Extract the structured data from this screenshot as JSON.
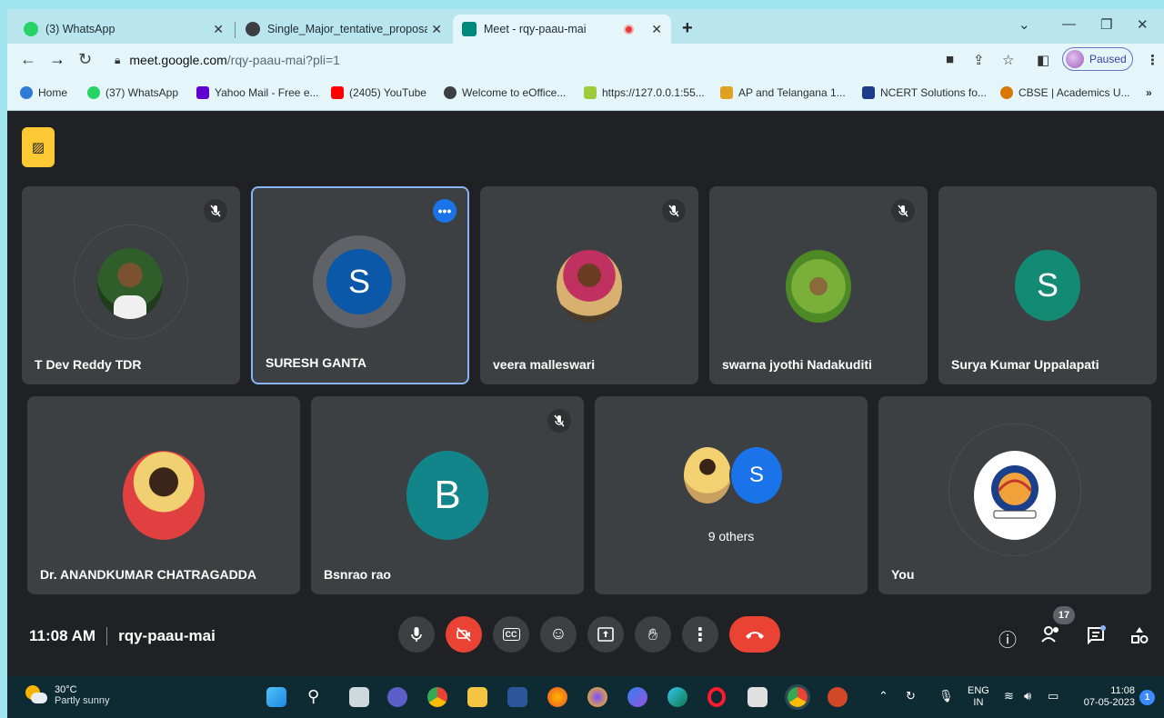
{
  "browser": {
    "tabs": [
      {
        "title": "(3) WhatsApp",
        "icon": "whatsapp-icon"
      },
      {
        "title": "Single_Major_tentative_proposal",
        "icon": "globe-icon"
      },
      {
        "title": "Meet - rqy-paau-mai",
        "icon": "meet-icon"
      }
    ],
    "url_host": "meet.google.com",
    "url_path": "/rqy-paau-mai?pli=1",
    "profile_status": "Paused",
    "bookmarks": [
      {
        "label": "Home",
        "color": "#2f7bd6"
      },
      {
        "label": "(37) WhatsApp",
        "color": "#25d366"
      },
      {
        "label": "Yahoo Mail - Free e...",
        "color": "#6001d2"
      },
      {
        "label": "(2405) YouTube",
        "color": "#ff0000"
      },
      {
        "label": "Welcome to eOffice...",
        "color": "#3c4043"
      },
      {
        "label": "https://127.0.0.1:55...",
        "color": "#9ccc3c"
      },
      {
        "label": "AP and Telangana 1...",
        "color": "#e0a020"
      },
      {
        "label": "NCERT Solutions fo...",
        "color": "#1e3a8a"
      },
      {
        "label": "CBSE | Academics U...",
        "color": "#d97706"
      }
    ]
  },
  "meet": {
    "participants_row1": [
      {
        "name": "T Dev Reddy TDR",
        "type": "photo",
        "muted": true
      },
      {
        "name": "SURESH GANTA",
        "type": "letter",
        "letter": "S",
        "color": "#0b57a8",
        "muted": false
      },
      {
        "name": "veera malleswari",
        "type": "photo",
        "muted": true
      },
      {
        "name": "swarna jyothi Nadakuditi",
        "type": "photo",
        "muted": true
      },
      {
        "name": "Surya Kumar Uppalapati",
        "type": "letter",
        "letter": "S",
        "color": "#138a73",
        "muted": false
      }
    ],
    "participants_row2": [
      {
        "name": "Dr. ANANDKUMAR CHATRAGADDA",
        "type": "photo",
        "muted": false
      },
      {
        "name": "Bsnrao rao",
        "type": "letter",
        "letter": "B",
        "color": "#12858a",
        "muted": true
      },
      {
        "name": "9 others",
        "type": "group",
        "letter": "S"
      },
      {
        "name": "You",
        "type": "logo"
      }
    ],
    "time": "11:08 AM",
    "meeting_code": "rqy-paau-mai",
    "people_count": "17"
  },
  "taskbar": {
    "temperature": "30°C",
    "weather": "Partly sunny",
    "lang1": "ENG",
    "lang2": "IN",
    "time": "11:08",
    "date": "07-05-2023",
    "notifications": "1"
  }
}
